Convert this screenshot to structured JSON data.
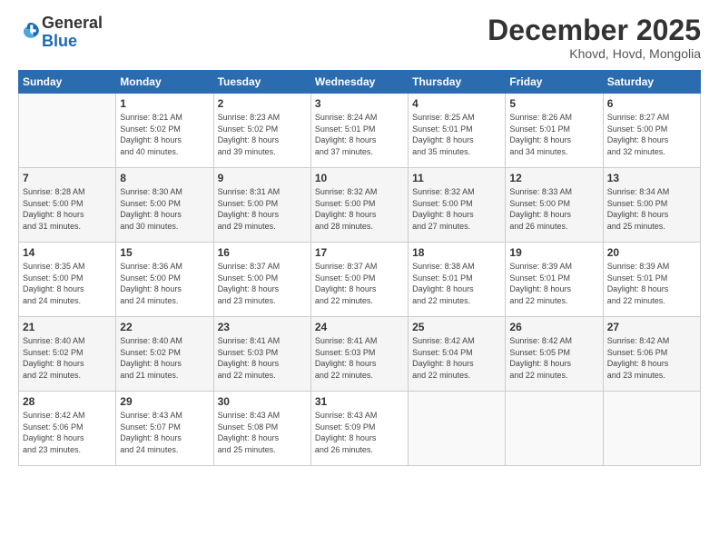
{
  "header": {
    "logo_general": "General",
    "logo_blue": "Blue",
    "month": "December 2025",
    "location": "Khovd, Hovd, Mongolia"
  },
  "days_of_week": [
    "Sunday",
    "Monday",
    "Tuesday",
    "Wednesday",
    "Thursday",
    "Friday",
    "Saturday"
  ],
  "weeks": [
    [
      {
        "day": "",
        "info": ""
      },
      {
        "day": "1",
        "info": "Sunrise: 8:21 AM\nSunset: 5:02 PM\nDaylight: 8 hours\nand 40 minutes."
      },
      {
        "day": "2",
        "info": "Sunrise: 8:23 AM\nSunset: 5:02 PM\nDaylight: 8 hours\nand 39 minutes."
      },
      {
        "day": "3",
        "info": "Sunrise: 8:24 AM\nSunset: 5:01 PM\nDaylight: 8 hours\nand 37 minutes."
      },
      {
        "day": "4",
        "info": "Sunrise: 8:25 AM\nSunset: 5:01 PM\nDaylight: 8 hours\nand 35 minutes."
      },
      {
        "day": "5",
        "info": "Sunrise: 8:26 AM\nSunset: 5:01 PM\nDaylight: 8 hours\nand 34 minutes."
      },
      {
        "day": "6",
        "info": "Sunrise: 8:27 AM\nSunset: 5:00 PM\nDaylight: 8 hours\nand 32 minutes."
      }
    ],
    [
      {
        "day": "7",
        "info": "Sunrise: 8:28 AM\nSunset: 5:00 PM\nDaylight: 8 hours\nand 31 minutes."
      },
      {
        "day": "8",
        "info": "Sunrise: 8:30 AM\nSunset: 5:00 PM\nDaylight: 8 hours\nand 30 minutes."
      },
      {
        "day": "9",
        "info": "Sunrise: 8:31 AM\nSunset: 5:00 PM\nDaylight: 8 hours\nand 29 minutes."
      },
      {
        "day": "10",
        "info": "Sunrise: 8:32 AM\nSunset: 5:00 PM\nDaylight: 8 hours\nand 28 minutes."
      },
      {
        "day": "11",
        "info": "Sunrise: 8:32 AM\nSunset: 5:00 PM\nDaylight: 8 hours\nand 27 minutes."
      },
      {
        "day": "12",
        "info": "Sunrise: 8:33 AM\nSunset: 5:00 PM\nDaylight: 8 hours\nand 26 minutes."
      },
      {
        "day": "13",
        "info": "Sunrise: 8:34 AM\nSunset: 5:00 PM\nDaylight: 8 hours\nand 25 minutes."
      }
    ],
    [
      {
        "day": "14",
        "info": "Sunrise: 8:35 AM\nSunset: 5:00 PM\nDaylight: 8 hours\nand 24 minutes."
      },
      {
        "day": "15",
        "info": "Sunrise: 8:36 AM\nSunset: 5:00 PM\nDaylight: 8 hours\nand 24 minutes."
      },
      {
        "day": "16",
        "info": "Sunrise: 8:37 AM\nSunset: 5:00 PM\nDaylight: 8 hours\nand 23 minutes."
      },
      {
        "day": "17",
        "info": "Sunrise: 8:37 AM\nSunset: 5:00 PM\nDaylight: 8 hours\nand 22 minutes."
      },
      {
        "day": "18",
        "info": "Sunrise: 8:38 AM\nSunset: 5:01 PM\nDaylight: 8 hours\nand 22 minutes."
      },
      {
        "day": "19",
        "info": "Sunrise: 8:39 AM\nSunset: 5:01 PM\nDaylight: 8 hours\nand 22 minutes."
      },
      {
        "day": "20",
        "info": "Sunrise: 8:39 AM\nSunset: 5:01 PM\nDaylight: 8 hours\nand 22 minutes."
      }
    ],
    [
      {
        "day": "21",
        "info": "Sunrise: 8:40 AM\nSunset: 5:02 PM\nDaylight: 8 hours\nand 22 minutes."
      },
      {
        "day": "22",
        "info": "Sunrise: 8:40 AM\nSunset: 5:02 PM\nDaylight: 8 hours\nand 21 minutes."
      },
      {
        "day": "23",
        "info": "Sunrise: 8:41 AM\nSunset: 5:03 PM\nDaylight: 8 hours\nand 22 minutes."
      },
      {
        "day": "24",
        "info": "Sunrise: 8:41 AM\nSunset: 5:03 PM\nDaylight: 8 hours\nand 22 minutes."
      },
      {
        "day": "25",
        "info": "Sunrise: 8:42 AM\nSunset: 5:04 PM\nDaylight: 8 hours\nand 22 minutes."
      },
      {
        "day": "26",
        "info": "Sunrise: 8:42 AM\nSunset: 5:05 PM\nDaylight: 8 hours\nand 22 minutes."
      },
      {
        "day": "27",
        "info": "Sunrise: 8:42 AM\nSunset: 5:06 PM\nDaylight: 8 hours\nand 23 minutes."
      }
    ],
    [
      {
        "day": "28",
        "info": "Sunrise: 8:42 AM\nSunset: 5:06 PM\nDaylight: 8 hours\nand 23 minutes."
      },
      {
        "day": "29",
        "info": "Sunrise: 8:43 AM\nSunset: 5:07 PM\nDaylight: 8 hours\nand 24 minutes."
      },
      {
        "day": "30",
        "info": "Sunrise: 8:43 AM\nSunset: 5:08 PM\nDaylight: 8 hours\nand 25 minutes."
      },
      {
        "day": "31",
        "info": "Sunrise: 8:43 AM\nSunset: 5:09 PM\nDaylight: 8 hours\nand 26 minutes."
      },
      {
        "day": "",
        "info": ""
      },
      {
        "day": "",
        "info": ""
      },
      {
        "day": "",
        "info": ""
      }
    ]
  ]
}
